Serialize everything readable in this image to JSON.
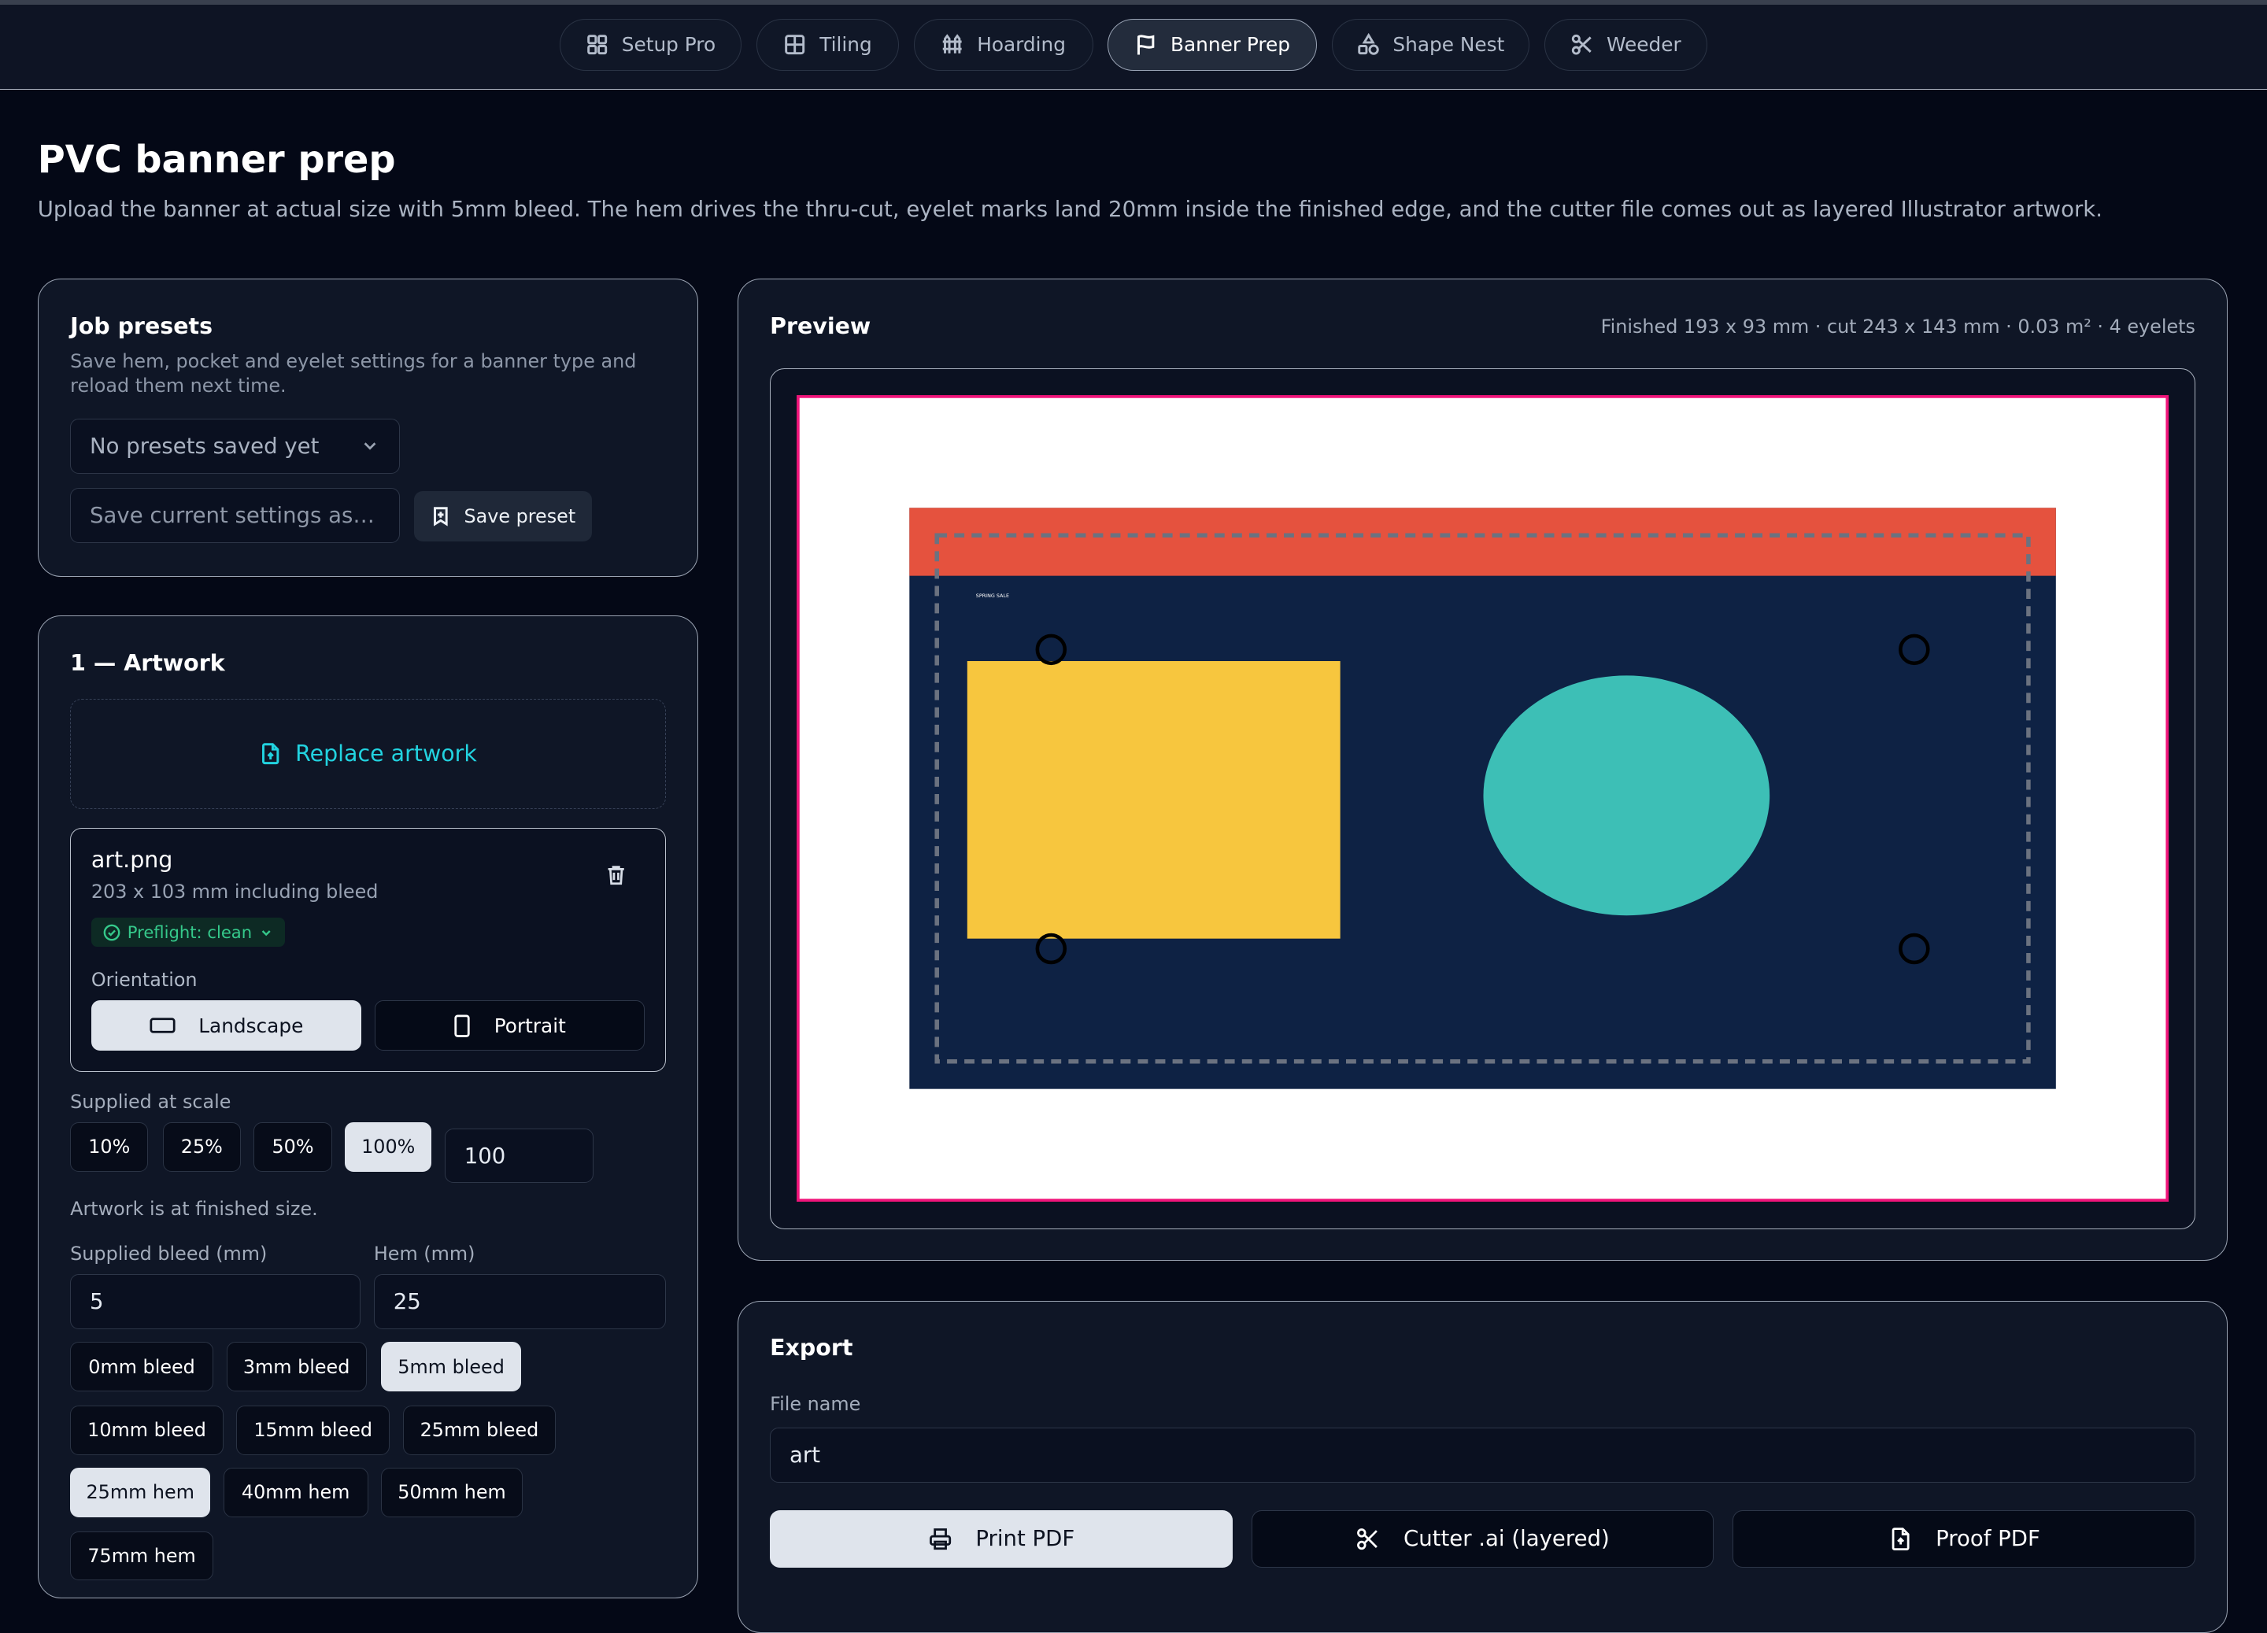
{
  "nav": {
    "tabs": [
      {
        "label": "Setup Pro",
        "icon": "grid-icon"
      },
      {
        "label": "Tiling",
        "icon": "tiles-icon"
      },
      {
        "label": "Hoarding",
        "icon": "fence-icon"
      },
      {
        "label": "Banner Prep",
        "icon": "flag-icon",
        "active": true
      },
      {
        "label": "Shape Nest",
        "icon": "shapes-icon"
      },
      {
        "label": "Weeder",
        "icon": "scissors-icon"
      }
    ]
  },
  "page": {
    "title": "PVC banner prep",
    "subtitle": "Upload the banner at actual size with 5mm bleed. The hem drives the thru-cut, eyelet marks land 20mm inside the finished edge, and the cutter file comes out as layered Illustrator artwork."
  },
  "presets": {
    "title": "Job presets",
    "description": "Save hem, pocket and eyelet settings for a banner type and reload them next time.",
    "select_value": "No presets saved yet",
    "name_placeholder": "Save current settings as…",
    "save_label": "Save preset"
  },
  "artwork": {
    "title": "1 — Artwork",
    "replace_label": "Replace artwork",
    "file": {
      "name": "art.png",
      "meta": "203 x 103 mm including bleed",
      "preflight": "Preflight: clean"
    },
    "orientation": {
      "label": "Orientation",
      "options": [
        "Landscape",
        "Portrait"
      ],
      "selected": "Landscape"
    },
    "scale": {
      "label": "Supplied at scale",
      "options": [
        "10%",
        "25%",
        "50%",
        "100%"
      ],
      "selected": "100%",
      "value": "100",
      "note": "Artwork is at finished size."
    },
    "bleed": {
      "label": "Supplied bleed (mm)",
      "value": "5"
    },
    "hem": {
      "label": "Hem (mm)",
      "value": "25"
    },
    "bleed_chips": [
      "0mm bleed",
      "3mm bleed",
      "5mm bleed",
      "10mm bleed",
      "15mm bleed",
      "25mm bleed"
    ],
    "bleed_selected": "5mm bleed",
    "hem_chips": [
      "25mm hem",
      "40mm hem",
      "50mm hem",
      "75mm hem"
    ],
    "hem_selected": "25mm hem"
  },
  "preview": {
    "title": "Preview",
    "summary": "Finished 193 x 93 mm · cut 243 x 143 mm · 0.03 m² · 4 eyelets",
    "art_text": "SPRING SALE",
    "colors": {
      "cut_line": "#f0147a",
      "header_band": "#e5523e",
      "background": "#0e2244",
      "rectangle": "#f7c63e",
      "circle": "#3dbfb6",
      "finished_edge": "#6b7280"
    },
    "eyelets": 4
  },
  "export": {
    "title": "Export",
    "file_name_label": "File name",
    "file_name_value": "art",
    "buttons": [
      {
        "label": "Print PDF",
        "icon": "printer-icon"
      },
      {
        "label": "Cutter .ai (layered)",
        "icon": "scissors-icon"
      },
      {
        "label": "Proof PDF",
        "icon": "file-export-icon"
      }
    ]
  }
}
